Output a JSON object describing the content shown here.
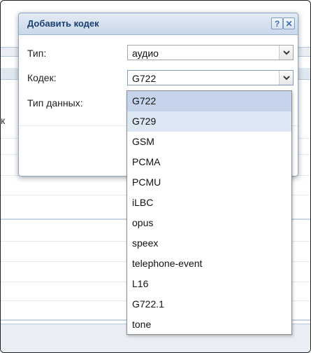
{
  "background": {
    "partial_letter": "к"
  },
  "dialog": {
    "title": "Добавить кодек",
    "help_label": "?",
    "close_label": "✕",
    "fields": {
      "type_label": "Тип:",
      "type_value": "аудио",
      "codec_label": "Кодек:",
      "codec_value": "G722",
      "datatype_label": "Тип данных:"
    }
  },
  "dropdown": {
    "selected": "G722",
    "hovered": "G729",
    "options": [
      "G722",
      "G729",
      "GSM",
      "PCMA",
      "PCMU",
      "iLBC",
      "opus",
      "speex",
      "telephone-event",
      "L16",
      "G722.1",
      "tone"
    ]
  },
  "icons": {
    "select_arrow": "chevron-down-icon",
    "help": "help-icon",
    "close": "close-icon"
  },
  "colors": {
    "title_text": "#1a3e73",
    "header_gradient_top": "#e3ebf5",
    "header_gradient_bottom": "#c9d8ea",
    "selected_option": "#c5d4ea",
    "hovered_option": "#dde6f3"
  }
}
